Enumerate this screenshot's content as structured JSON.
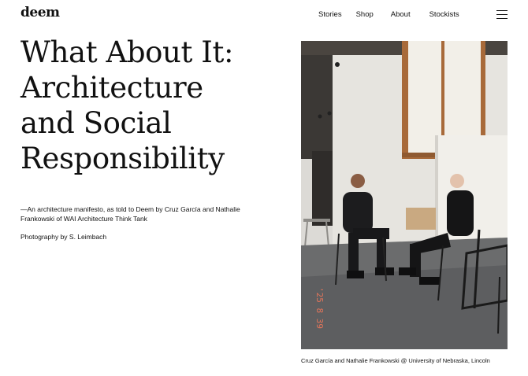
{
  "header": {
    "logo": "deem",
    "nav": [
      {
        "label": "Stories"
      },
      {
        "label": "Shop"
      },
      {
        "label": "About"
      },
      {
        "label": "Stockists"
      }
    ]
  },
  "article": {
    "title_lines": [
      "What About It:",
      "Architecture",
      "and Social",
      "Responsibility"
    ],
    "deck": "—An architecture manifesto, as told to Deem by Cruz García and Nathalie Frankowski of WAI Architecture Think Tank",
    "photo_credit": "Photography by S. Leimbach"
  },
  "photo": {
    "date_stamp": "'25 8 39",
    "caption": "Cruz García and Nathalie Frankowski @ University of Nebraska, Lincoln"
  },
  "colors": {
    "text": "#111111",
    "background": "#ffffff",
    "date_stamp": "#e0745a"
  }
}
